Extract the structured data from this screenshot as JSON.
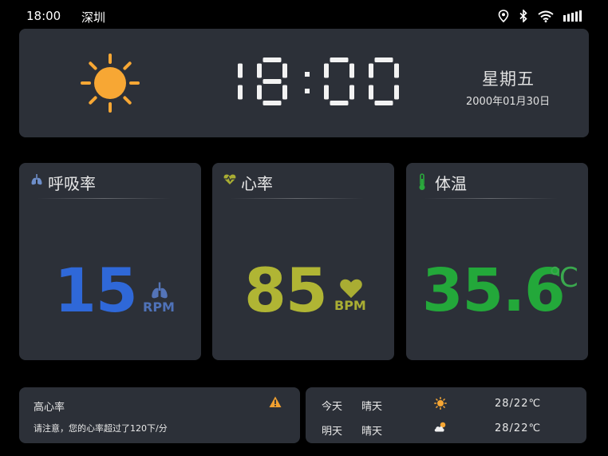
{
  "status_bar": {
    "time": "18:00",
    "city": "深圳",
    "icons": [
      "location-icon",
      "bluetooth-icon",
      "wifi-icon",
      "signal-icon"
    ]
  },
  "clock": {
    "time_display": "18:00",
    "weekday": "星期五",
    "date": "2000年01月30日",
    "weather_icon": "sun-icon"
  },
  "vitals": {
    "respiration": {
      "title": "呼吸率",
      "value": "15",
      "unit": "RPM",
      "color": "#2f68d8",
      "icon": "lungs-icon"
    },
    "heart_rate": {
      "title": "心率",
      "value": "85",
      "unit": "BPM",
      "color": "#b0b534",
      "icon": "heart-pulse-icon"
    },
    "temperature": {
      "title": "体温",
      "value": "35.6",
      "unit": "℃",
      "color": "#23a83a",
      "icon": "thermometer-icon"
    }
  },
  "alert": {
    "title": "高心率",
    "message": "请注意，您的心率超过了120下/分",
    "icon": "warning-icon",
    "icon_color": "#f0a030"
  },
  "forecast": [
    {
      "day": "今天",
      "condition": "晴天",
      "icon": "sun-icon",
      "temp": "28/22℃"
    },
    {
      "day": "明天",
      "condition": "晴天",
      "icon": "cloud-sun-icon",
      "temp": "28/22℃"
    }
  ]
}
